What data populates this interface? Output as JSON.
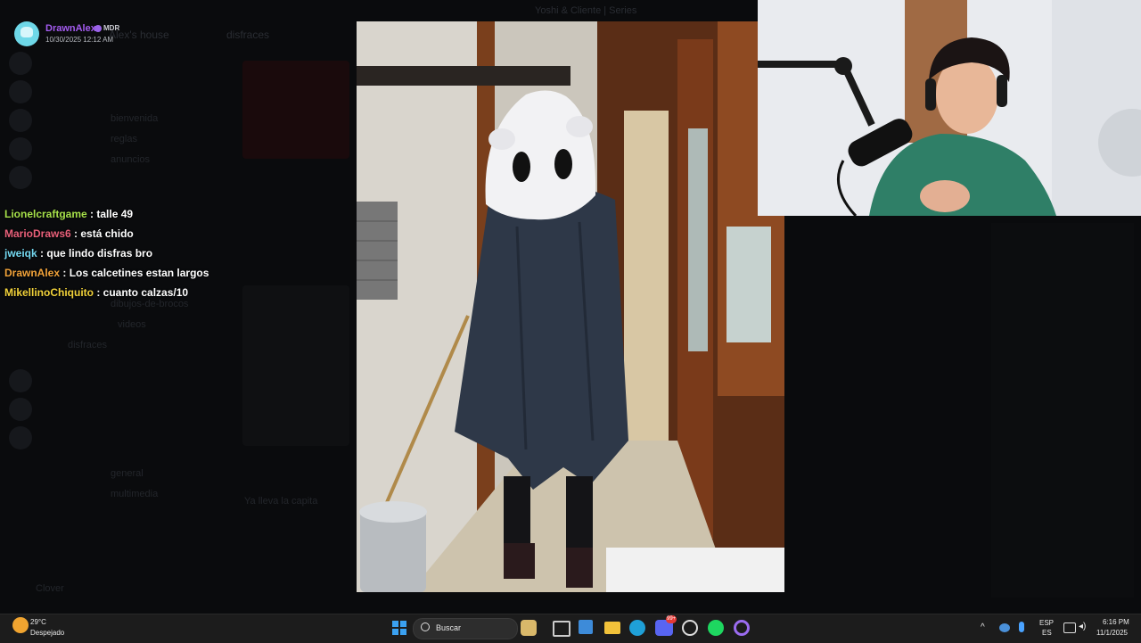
{
  "stream_title": "Yoshi & Cliente | Series",
  "message": {
    "username": "DrawnAlex",
    "badge": "MDR",
    "timestamp": "10/30/2025 12:12 AM"
  },
  "chat": [
    {
      "user": "Lionelcraftgame",
      "text": "talle 49",
      "color": "#a6e04a"
    },
    {
      "user": "MarioDraws6",
      "text": "está chido",
      "color": "#e8607a"
    },
    {
      "user": "jweiqk",
      "text": "que lindo disfras bro",
      "color": "#74d8f0"
    },
    {
      "user": "DrawnAlex",
      "text": "Los calcetines estan largos",
      "color": "#f2a33a"
    },
    {
      "user": "MikellinoChiquito",
      "text": "cuanto calzas/10",
      "color": "#f2d23a"
    }
  ],
  "background_ghost": {
    "server_name": "Alex's house",
    "channels": [
      "bienvenida",
      "reglas",
      "anuncios",
      "disfraces",
      "general",
      "dibujos-de-brocos",
      "videos",
      "multimedia"
    ],
    "active_channel": "disfraces",
    "input_placeholder": "Ya lleva la capita",
    "user": "Clover"
  },
  "taskbar": {
    "weather_temp": "29°C",
    "weather_desc": "Despejado",
    "search_placeholder": "Buscar",
    "lang_top": "ESP",
    "lang_bottom": "ES",
    "time": "6:16 PM",
    "date": "11/1/2025",
    "discord_badge": "99+"
  },
  "colors": {
    "taskbar": "#1c1c1c",
    "accent_purple": "#a45cf0"
  }
}
